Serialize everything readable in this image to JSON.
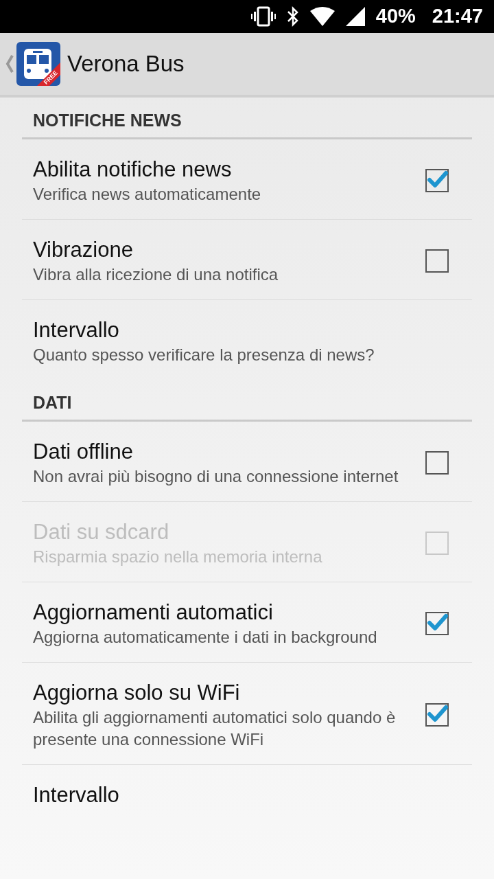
{
  "status_bar": {
    "battery": "40%",
    "time": "21:47"
  },
  "app_bar": {
    "title": "Verona Bus",
    "icon_badge": "FREE"
  },
  "sections": [
    {
      "header": "NOTIFICHE NEWS",
      "items": [
        {
          "kind": "checkbox",
          "title": "Abilita notifiche news",
          "summary": "Verifica news automaticamente",
          "checked": true,
          "disabled": false
        },
        {
          "kind": "checkbox",
          "title": "Vibrazione",
          "summary": "Vibra alla ricezione di una notifica",
          "checked": false,
          "disabled": false
        },
        {
          "kind": "plain",
          "title": "Intervallo",
          "summary": "Quanto spesso verificare la presenza di news?",
          "disabled": false
        }
      ]
    },
    {
      "header": "DATI",
      "items": [
        {
          "kind": "checkbox",
          "title": "Dati offline",
          "summary": "Non avrai più bisogno di una connessione internet",
          "checked": false,
          "disabled": false
        },
        {
          "kind": "checkbox",
          "title": "Dati su sdcard",
          "summary": "Risparmia spazio nella memoria interna",
          "checked": false,
          "disabled": true
        },
        {
          "kind": "checkbox",
          "title": "Aggiornamenti automatici",
          "summary": "Aggiorna automaticamente i dati in background",
          "checked": true,
          "disabled": false
        },
        {
          "kind": "checkbox",
          "title": "Aggiorna solo su WiFi",
          "summary": "Abilita gli aggiornamenti automatici solo quando è presente una connessione WiFi",
          "checked": true,
          "disabled": false
        },
        {
          "kind": "plain",
          "title": "Intervallo",
          "disabled": false
        }
      ]
    }
  ]
}
